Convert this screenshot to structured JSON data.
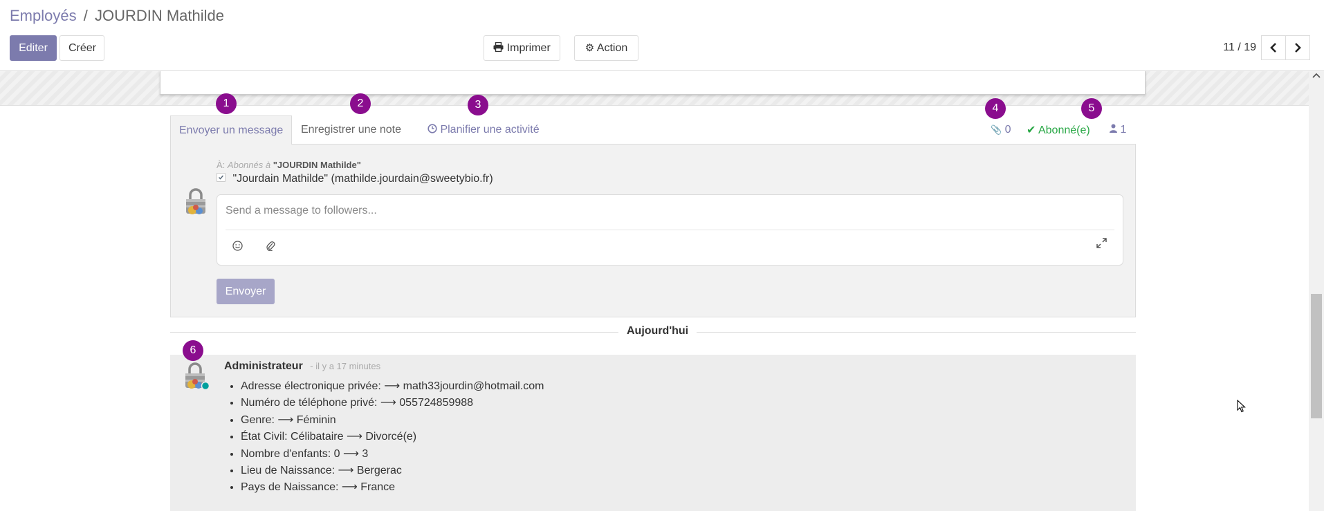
{
  "breadcrumb": {
    "parent": "Employés",
    "separator": "/",
    "current": "JOURDIN Mathilde"
  },
  "buttons": {
    "edit": "Editer",
    "create": "Créer",
    "print": "Imprimer",
    "action": "Action"
  },
  "pager": {
    "value": "11 / 19"
  },
  "chatter": {
    "tabs": {
      "send_message": "Envoyer un message",
      "log_note": "Enregistrer une note",
      "schedule_activity": "Planifier une activité"
    },
    "attachments_count": "0",
    "follow_status": "Abonné(e)",
    "followers_count": "1",
    "composer": {
      "to_label": "À:",
      "to_prefix": "Abonnés à",
      "to_record": "\"JOURDIN Mathilde\"",
      "recipient": "\"Jourdain Mathilde\" (mathilde.jourdain@sweetybio.fr)",
      "placeholder": "Send a message to followers...",
      "send_label": "Envoyer"
    },
    "day_separator": "Aujourd'hui",
    "message": {
      "author": "Administrateur",
      "time": "- il y a 17 minutes",
      "changes": [
        "Adresse électronique privée: ⟶ math33jourdin@hotmail.com",
        "Numéro de téléphone privé: ⟶ 055724859988",
        "Genre: ⟶ Féminin",
        "État Civil: Célibataire ⟶ Divorcé(e)",
        "Nombre d'enfants: 0 ⟶ 3",
        "Lieu de Naissance: ⟶ Bergerac",
        "Pays de Naissance: ⟶ France"
      ]
    }
  },
  "markers": [
    "1",
    "2",
    "3",
    "4",
    "5",
    "6"
  ],
  "colors": {
    "accent": "#7c7bad",
    "success": "#28a745",
    "marker": "#8a0d8e",
    "online": "#00a09d"
  }
}
